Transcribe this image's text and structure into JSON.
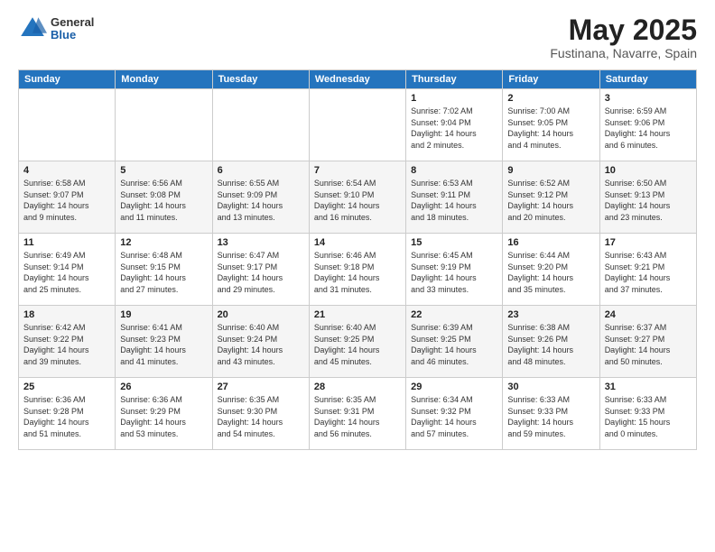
{
  "header": {
    "logo_general": "General",
    "logo_blue": "Blue",
    "month": "May 2025",
    "location": "Fustinana, Navarre, Spain"
  },
  "days_of_week": [
    "Sunday",
    "Monday",
    "Tuesday",
    "Wednesday",
    "Thursday",
    "Friday",
    "Saturday"
  ],
  "weeks": [
    [
      {
        "day": "",
        "info": ""
      },
      {
        "day": "",
        "info": ""
      },
      {
        "day": "",
        "info": ""
      },
      {
        "day": "",
        "info": ""
      },
      {
        "day": "1",
        "info": "Sunrise: 7:02 AM\nSunset: 9:04 PM\nDaylight: 14 hours\nand 2 minutes."
      },
      {
        "day": "2",
        "info": "Sunrise: 7:00 AM\nSunset: 9:05 PM\nDaylight: 14 hours\nand 4 minutes."
      },
      {
        "day": "3",
        "info": "Sunrise: 6:59 AM\nSunset: 9:06 PM\nDaylight: 14 hours\nand 6 minutes."
      }
    ],
    [
      {
        "day": "4",
        "info": "Sunrise: 6:58 AM\nSunset: 9:07 PM\nDaylight: 14 hours\nand 9 minutes."
      },
      {
        "day": "5",
        "info": "Sunrise: 6:56 AM\nSunset: 9:08 PM\nDaylight: 14 hours\nand 11 minutes."
      },
      {
        "day": "6",
        "info": "Sunrise: 6:55 AM\nSunset: 9:09 PM\nDaylight: 14 hours\nand 13 minutes."
      },
      {
        "day": "7",
        "info": "Sunrise: 6:54 AM\nSunset: 9:10 PM\nDaylight: 14 hours\nand 16 minutes."
      },
      {
        "day": "8",
        "info": "Sunrise: 6:53 AM\nSunset: 9:11 PM\nDaylight: 14 hours\nand 18 minutes."
      },
      {
        "day": "9",
        "info": "Sunrise: 6:52 AM\nSunset: 9:12 PM\nDaylight: 14 hours\nand 20 minutes."
      },
      {
        "day": "10",
        "info": "Sunrise: 6:50 AM\nSunset: 9:13 PM\nDaylight: 14 hours\nand 23 minutes."
      }
    ],
    [
      {
        "day": "11",
        "info": "Sunrise: 6:49 AM\nSunset: 9:14 PM\nDaylight: 14 hours\nand 25 minutes."
      },
      {
        "day": "12",
        "info": "Sunrise: 6:48 AM\nSunset: 9:15 PM\nDaylight: 14 hours\nand 27 minutes."
      },
      {
        "day": "13",
        "info": "Sunrise: 6:47 AM\nSunset: 9:17 PM\nDaylight: 14 hours\nand 29 minutes."
      },
      {
        "day": "14",
        "info": "Sunrise: 6:46 AM\nSunset: 9:18 PM\nDaylight: 14 hours\nand 31 minutes."
      },
      {
        "day": "15",
        "info": "Sunrise: 6:45 AM\nSunset: 9:19 PM\nDaylight: 14 hours\nand 33 minutes."
      },
      {
        "day": "16",
        "info": "Sunrise: 6:44 AM\nSunset: 9:20 PM\nDaylight: 14 hours\nand 35 minutes."
      },
      {
        "day": "17",
        "info": "Sunrise: 6:43 AM\nSunset: 9:21 PM\nDaylight: 14 hours\nand 37 minutes."
      }
    ],
    [
      {
        "day": "18",
        "info": "Sunrise: 6:42 AM\nSunset: 9:22 PM\nDaylight: 14 hours\nand 39 minutes."
      },
      {
        "day": "19",
        "info": "Sunrise: 6:41 AM\nSunset: 9:23 PM\nDaylight: 14 hours\nand 41 minutes."
      },
      {
        "day": "20",
        "info": "Sunrise: 6:40 AM\nSunset: 9:24 PM\nDaylight: 14 hours\nand 43 minutes."
      },
      {
        "day": "21",
        "info": "Sunrise: 6:40 AM\nSunset: 9:25 PM\nDaylight: 14 hours\nand 45 minutes."
      },
      {
        "day": "22",
        "info": "Sunrise: 6:39 AM\nSunset: 9:25 PM\nDaylight: 14 hours\nand 46 minutes."
      },
      {
        "day": "23",
        "info": "Sunrise: 6:38 AM\nSunset: 9:26 PM\nDaylight: 14 hours\nand 48 minutes."
      },
      {
        "day": "24",
        "info": "Sunrise: 6:37 AM\nSunset: 9:27 PM\nDaylight: 14 hours\nand 50 minutes."
      }
    ],
    [
      {
        "day": "25",
        "info": "Sunrise: 6:36 AM\nSunset: 9:28 PM\nDaylight: 14 hours\nand 51 minutes."
      },
      {
        "day": "26",
        "info": "Sunrise: 6:36 AM\nSunset: 9:29 PM\nDaylight: 14 hours\nand 53 minutes."
      },
      {
        "day": "27",
        "info": "Sunrise: 6:35 AM\nSunset: 9:30 PM\nDaylight: 14 hours\nand 54 minutes."
      },
      {
        "day": "28",
        "info": "Sunrise: 6:35 AM\nSunset: 9:31 PM\nDaylight: 14 hours\nand 56 minutes."
      },
      {
        "day": "29",
        "info": "Sunrise: 6:34 AM\nSunset: 9:32 PM\nDaylight: 14 hours\nand 57 minutes."
      },
      {
        "day": "30",
        "info": "Sunrise: 6:33 AM\nSunset: 9:33 PM\nDaylight: 14 hours\nand 59 minutes."
      },
      {
        "day": "31",
        "info": "Sunrise: 6:33 AM\nSunset: 9:33 PM\nDaylight: 15 hours\nand 0 minutes."
      }
    ]
  ]
}
